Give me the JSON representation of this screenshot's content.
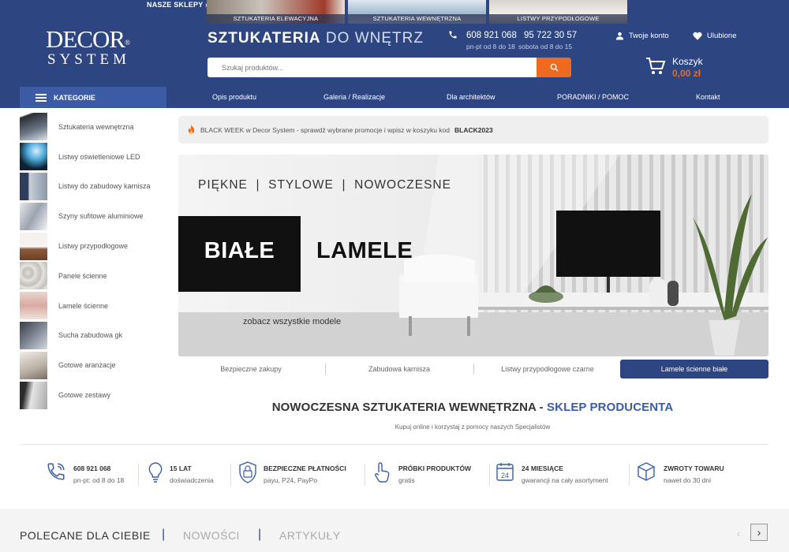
{
  "topbar": {
    "shops_label": "NASZE SKLEPY ›",
    "shops": [
      "SZTUKATERIA ELEWACYJNA",
      "SZTUKATERIA WEWNĘTRZNA",
      "LISTWY PRZYPODŁOGOWE"
    ]
  },
  "logo": {
    "line1": "DECOR",
    "reg": "®",
    "line2": "SYSTEM"
  },
  "header": {
    "title_bold": "SZTUKATERIA",
    "title_light": "DO WNĘTRZ",
    "phone1": "608 921 068",
    "phone2": "95 722 30 57",
    "hours1": "pn-pt od 8 do 18",
    "hours2": "sobota od 8 do 15",
    "account": "Twoje konto",
    "favorites": "Ulubione",
    "search_placeholder": "Szukaj produktów...",
    "cart_label": "Koszyk",
    "cart_value": "0,00 zł"
  },
  "nav": {
    "categories": "KATEGORIE",
    "links": [
      "Opis produktu",
      "Galeria / Realizacje",
      "Dla architektów",
      "PORADNIKI / POMOC",
      "Kontakt"
    ]
  },
  "sidebar": {
    "items": [
      {
        "label": "Sztukateria wewnętrzna"
      },
      {
        "label": "Listwy oświetleniowe LED"
      },
      {
        "label": "Listwy do zabudowy karnisza"
      },
      {
        "label": "Szyny sufitowe aluminiowe"
      },
      {
        "label": "Listwy przypodłogowe"
      },
      {
        "label": "Panele ścienne"
      },
      {
        "label": "Lamele ścienne"
      },
      {
        "label": "Sucha zabudowa gk"
      },
      {
        "label": "Gotowe aranżacje"
      },
      {
        "label": "Gotowe zestawy"
      }
    ]
  },
  "promo": {
    "text": "BLACK WEEK w Decor System - sprawdź wybrane promocje i wpisz w koszyku kod",
    "code": "BLACK2023"
  },
  "banner": {
    "tagline": "PIĘKNE  |  STYLOWE  |  NOWOCZESNE",
    "word1": "BIAŁE",
    "word2": "LAMELE",
    "cta": "zobacz wszystkie modele",
    "tabs": [
      "Bezpieczne zakupy",
      "Zabudowa karnisza",
      "Listwy przypodłogowe czarne",
      "Lamele ścienne białe"
    ]
  },
  "section": {
    "heading_main": "NOWOCZESNA SZTUKATERIA WEWNĘTRZNA -",
    "heading_accent": "SKLEP PRODUCENTA",
    "sub": "Kupuj online i korzystaj z pomocy naszych Specjalistów"
  },
  "features": [
    {
      "title": "608 921 068",
      "sub": "pn-pt: od 8 do 18",
      "icon": "phone-icon"
    },
    {
      "title": "15 LAT",
      "sub": "doświadczenia",
      "icon": "lightbulb-icon"
    },
    {
      "title": "BEZPIECZNE PŁATNOŚCI",
      "sub": "payu, P24, PayPo",
      "icon": "ssl-lock-icon"
    },
    {
      "title": "PRÓBKI PRODUKTÓW",
      "sub": "gratis",
      "icon": "hand-pointer-icon"
    },
    {
      "title": "24 MIESIĄCE",
      "sub": "gwarancji na cały asortyment",
      "icon": "calendar-icon"
    },
    {
      "title": "ZWROTY TOWARU",
      "sub": "nawet do 30 dni",
      "icon": "box-icon"
    }
  ],
  "bottom_tabs": [
    "POLECANE DLA CIEBIE",
    "NOWOŚCI",
    "ARTYKUŁY"
  ],
  "colors": {
    "navy": "#2d4580",
    "accent": "#ed6a1f",
    "active_blue": "#3d5ba5"
  }
}
